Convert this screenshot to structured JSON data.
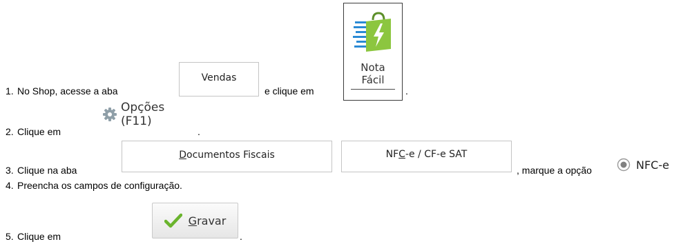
{
  "steps": [
    {
      "number": "1.",
      "text_before": "No Shop, acesse a aba",
      "text_middle": "e clique em",
      "text_after": "."
    },
    {
      "number": "2.",
      "text_before": "Clique em",
      "text_after": "."
    },
    {
      "number": "3.",
      "text_before": "Clique na aba",
      "text_middle": ", marque a opção"
    },
    {
      "number": "4.",
      "text": "Preencha os campos de configuração."
    },
    {
      "number": "5.",
      "text_before": "Clique em",
      "text_after": "."
    }
  ],
  "vendas_tab": {
    "label": "Vendas"
  },
  "nota_facil": {
    "line1": "Nota",
    "line2": "Fácil",
    "icon": "shopping-bag-lightning-icon",
    "accent": "#8cc63f"
  },
  "opcoes": {
    "label": "Opções (F11)",
    "icon": "gear-icon"
  },
  "documentos_tab": {
    "mnemonic": "D",
    "rest": "ocumentos Fiscais"
  },
  "nfce_tab": {
    "pre": "NF",
    "mnemonic": "C",
    "rest": "-e / CF-e SAT"
  },
  "nfce_radio": {
    "label": "NFC-e",
    "selected": true
  },
  "gravar_button": {
    "mnemonic": "G",
    "rest": "ravar",
    "icon": "checkmark-icon",
    "accent": "#6ab42d"
  }
}
